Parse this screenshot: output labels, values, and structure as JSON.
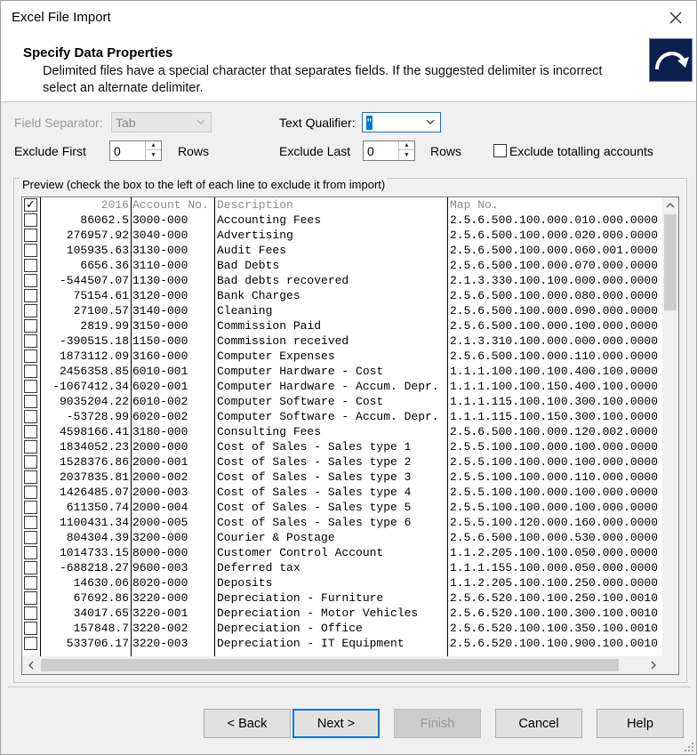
{
  "window": {
    "title": "Excel File Import"
  },
  "header": {
    "title": "Specify Data Properties",
    "description": "Delimited files have a special character that separates fields. If the suggested delimiter is incorrect select an alternate delimiter."
  },
  "options": {
    "field_separator_label": "Field Separator:",
    "field_separator_value": "Tab",
    "text_qualifier_label": "Text Qualifier:",
    "text_qualifier_value": "\"",
    "exclude_first_label": "Exclude First",
    "exclude_first_value": "0",
    "exclude_first_unit": "Rows",
    "exclude_last_label": "Exclude Last",
    "exclude_last_value": "0",
    "exclude_last_unit": "Rows",
    "exclude_totalling_label": "Exclude totalling accounts"
  },
  "preview": {
    "legend": "Preview (check the box to the left of each line to exclude it from import)",
    "header_row": {
      "amount": "2016",
      "account": "Account No.",
      "description": "Description",
      "map": "Map No.",
      "checked": true
    },
    "rows": [
      {
        "amount": "86062.5",
        "account": "3000-000",
        "description": "Accounting Fees",
        "map": "2.5.6.500.100.000.010.000.0000"
      },
      {
        "amount": "276957.92",
        "account": "3040-000",
        "description": "Advertising",
        "map": "2.5.6.500.100.000.020.000.0000"
      },
      {
        "amount": "105935.63",
        "account": "3130-000",
        "description": "Audit Fees",
        "map": "2.5.6.500.100.000.060.001.0000"
      },
      {
        "amount": "6656.36",
        "account": "3110-000",
        "description": "Bad Debts",
        "map": "2.5.6.500.100.000.070.000.0000"
      },
      {
        "amount": "-544507.07",
        "account": "1130-000",
        "description": "Bad debts recovered",
        "map": "2.1.3.330.100.100.000.000.0000"
      },
      {
        "amount": "75154.61",
        "account": "3120-000",
        "description": "Bank Charges",
        "map": "2.5.6.500.100.000.080.000.0000"
      },
      {
        "amount": "27100.57",
        "account": "3140-000",
        "description": "Cleaning",
        "map": "2.5.6.500.100.000.090.000.0000"
      },
      {
        "amount": "2819.99",
        "account": "3150-000",
        "description": "Commission Paid",
        "map": "2.5.6.500.100.000.100.000.0000"
      },
      {
        "amount": "-390515.18",
        "account": "1150-000",
        "description": "Commission received",
        "map": "2.1.3.310.100.000.000.000.0000"
      },
      {
        "amount": "1873112.09",
        "account": "3160-000",
        "description": "Computer Expenses",
        "map": "2.5.6.500.100.000.110.000.0000"
      },
      {
        "amount": "2456358.85",
        "account": "6010-001",
        "description": "Computer Hardware - Cost",
        "map": "1.1.1.100.100.100.400.100.0000"
      },
      {
        "amount": "-1067412.34",
        "account": "6020-001",
        "description": "Computer Hardware - Accum. Depr.",
        "map": "1.1.1.100.100.150.400.100.0000"
      },
      {
        "amount": "9035204.22",
        "account": "6010-002",
        "description": "Computer Software - Cost",
        "map": "1.1.1.115.100.100.300.100.0000"
      },
      {
        "amount": "-53728.99",
        "account": "6020-002",
        "description": "Computer Software - Accum. Depr.",
        "map": "1.1.1.115.100.150.300.100.0000"
      },
      {
        "amount": "4598166.41",
        "account": "3180-000",
        "description": "Consulting Fees",
        "map": "2.5.6.500.100.000.120.002.0000"
      },
      {
        "amount": "1834052.23",
        "account": "2000-000",
        "description": "Cost of Sales - Sales type 1",
        "map": "2.5.5.100.100.000.100.000.0000"
      },
      {
        "amount": "1528376.86",
        "account": "2000-001",
        "description": "Cost of Sales - Sales type 2",
        "map": "2.5.5.100.100.000.100.000.0000"
      },
      {
        "amount": "2037835.81",
        "account": "2000-002",
        "description": "Cost of Sales - Sales type 3",
        "map": "2.5.5.100.100.000.110.000.0000"
      },
      {
        "amount": "1426485.07",
        "account": "2000-003",
        "description": "Cost of Sales - Sales type 4",
        "map": "2.5.5.100.100.000.100.000.0000"
      },
      {
        "amount": "611350.74",
        "account": "2000-004",
        "description": "Cost of Sales - Sales type 5",
        "map": "2.5.5.100.100.000.100.000.0000"
      },
      {
        "amount": "1100431.34",
        "account": "2000-005",
        "description": "Cost of Sales - Sales type 6",
        "map": "2.5.5.100.120.000.160.000.0000"
      },
      {
        "amount": "804304.39",
        "account": "3200-000",
        "description": "Courier & Postage",
        "map": "2.5.6.500.100.000.530.000.0000"
      },
      {
        "amount": "1014733.15",
        "account": "8000-000",
        "description": "Customer Control Account",
        "map": "1.1.2.205.100.100.050.000.0000"
      },
      {
        "amount": "-688218.27",
        "account": "9600-003",
        "description": "Deferred tax",
        "map": "1.1.1.155.100.000.050.000.0000"
      },
      {
        "amount": "14630.06",
        "account": "8020-000",
        "description": "Deposits",
        "map": "1.1.2.205.100.100.250.000.0000"
      },
      {
        "amount": "67692.86",
        "account": "3220-000",
        "description": "Depreciation - Furniture",
        "map": "2.5.6.520.100.100.250.100.0010"
      },
      {
        "amount": "34017.65",
        "account": "3220-001",
        "description": "Depreciation - Motor Vehicles",
        "map": "2.5.6.520.100.100.300.100.0010"
      },
      {
        "amount": "157848.7",
        "account": "3220-002",
        "description": "Depreciation - Office",
        "map": "2.5.6.520.100.100.350.100.0010"
      },
      {
        "amount": "533706.17",
        "account": "3220-003",
        "description": "Depreciation - IT Equipment",
        "map": "2.5.6.520.100.100.900.100.0010"
      }
    ]
  },
  "buttons": {
    "back": "< Back",
    "next": "Next >",
    "finish": "Finish",
    "cancel": "Cancel",
    "help": "Help"
  }
}
